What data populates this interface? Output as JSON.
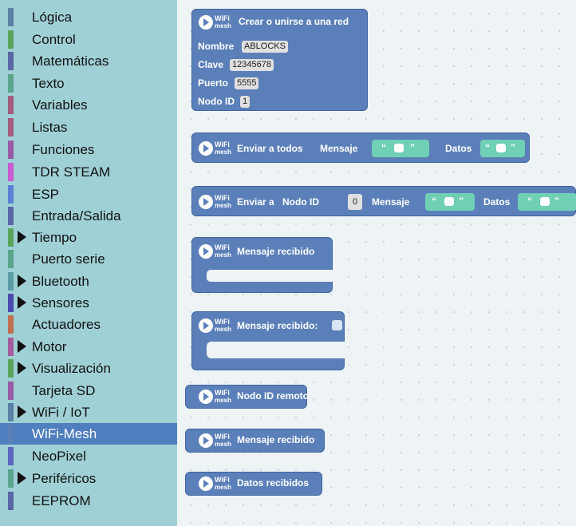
{
  "toolbox": {
    "categories": [
      {
        "label": "Lógica",
        "color": "#5b80a5",
        "arrow": false,
        "selected": false
      },
      {
        "label": "Control",
        "color": "#5ba55b",
        "arrow": false,
        "selected": false
      },
      {
        "label": "Matemáticas",
        "color": "#5b67a5",
        "arrow": false,
        "selected": false
      },
      {
        "label": "Texto",
        "color": "#5ba58c",
        "arrow": false,
        "selected": false
      },
      {
        "label": "Variables",
        "color": "#a55b80",
        "arrow": false,
        "selected": false
      },
      {
        "label": "Listas",
        "color": "#a55b80",
        "arrow": false,
        "selected": false
      },
      {
        "label": "Funciones",
        "color": "#995ba5",
        "arrow": false,
        "selected": false
      },
      {
        "label": "TDR STEAM",
        "color": "#c95bd0",
        "arrow": false,
        "selected": false
      },
      {
        "label": "ESP",
        "color": "#5b80d6",
        "arrow": false,
        "selected": false
      },
      {
        "label": "Entrada/Salida",
        "color": "#5b67a5",
        "arrow": false,
        "selected": false
      },
      {
        "label": "Tiempo",
        "color": "#5ba55b",
        "arrow": true,
        "selected": false
      },
      {
        "label": "Puerto serie",
        "color": "#5ba58c",
        "arrow": false,
        "selected": false
      },
      {
        "label": "Bluetooth",
        "color": "#5b9ca5",
        "arrow": true,
        "selected": false
      },
      {
        "label": "Sensores",
        "color": "#4a4ab0",
        "arrow": true,
        "selected": false
      },
      {
        "label": "Actuadores",
        "color": "#c07050",
        "arrow": false,
        "selected": false
      },
      {
        "label": "Motor",
        "color": "#a55b9c",
        "arrow": true,
        "selected": false
      },
      {
        "label": "Visualización",
        "color": "#5ba55b",
        "arrow": true,
        "selected": false
      },
      {
        "label": "Tarjeta SD",
        "color": "#995ba5",
        "arrow": false,
        "selected": false
      },
      {
        "label": "WiFi / IoT",
        "color": "#5b80a5",
        "arrow": true,
        "selected": false
      },
      {
        "label": "WiFi-Mesh",
        "color": "#5b80b9",
        "arrow": false,
        "selected": true
      },
      {
        "label": "NeoPixel",
        "color": "#5b67c0",
        "arrow": false,
        "selected": false
      },
      {
        "label": "Periféricos",
        "color": "#5ba58c",
        "arrow": true,
        "selected": false
      },
      {
        "label": "EEPROM",
        "color": "#5b67a5",
        "arrow": false,
        "selected": false
      }
    ]
  },
  "logo": {
    "wifi": "WiFi",
    "mesh": "mesh"
  },
  "blocks": {
    "create": {
      "title": "Crear o unirse a una red",
      "nombre_label": "Nombre",
      "nombre_value": "ABLOCKS",
      "clave_label": "Clave",
      "clave_value": "12345678",
      "puerto_label": "Puerto",
      "puerto_value": "5555",
      "nodo_label": "Nodo ID",
      "nodo_value": "1"
    },
    "send_all": {
      "title": "Enviar a todos",
      "mensaje_label": "Mensaje",
      "datos_label": "Datos"
    },
    "send_to": {
      "title": "Enviar a",
      "nodo_label": "Nodo ID",
      "nodo_value": "0",
      "mensaje_label": "Mensaje",
      "datos_label": "Datos"
    },
    "received": {
      "title": "Mensaje recibido"
    },
    "received_param": {
      "title": "Mensaje recibido:"
    },
    "remote_id": {
      "title": "Nodo ID remoto"
    },
    "received_value": {
      "title": "Mensaje recibido"
    },
    "data_received": {
      "title": "Datos recibidos"
    }
  },
  "string_quotes": {
    "open": "“",
    "close": "”"
  },
  "colors": {
    "block": "#5b80b9",
    "string": "#6fd0b6",
    "toolbox": "#9fd0d6",
    "selected": "#4f7fbf",
    "workspace": "#eef3f6"
  }
}
